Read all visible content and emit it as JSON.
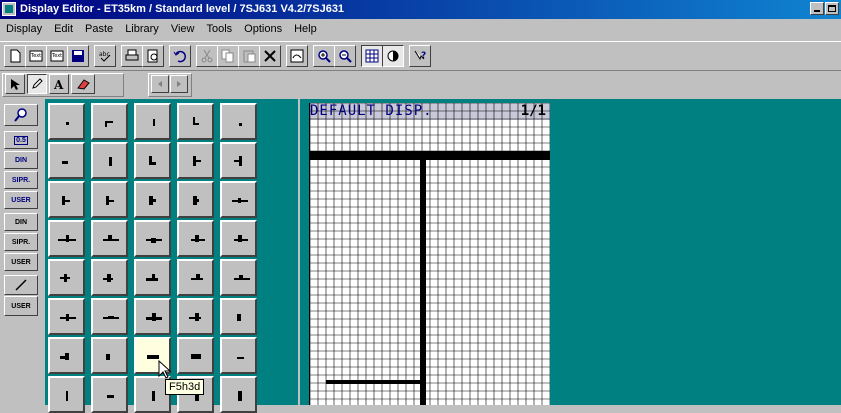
{
  "window": {
    "title": "Display Editor - ET35km / Standard level / 7SJ631 V4.2/7SJ631"
  },
  "menu": [
    "Display",
    "Edit",
    "Paste",
    "Library",
    "View",
    "Tools",
    "Options",
    "Help"
  ],
  "toolbar": {
    "icons": [
      "new-display-icon",
      "import-icon",
      "export-icon",
      "save-icon",
      "spell-check-icon",
      "print-icon",
      "print-preview-icon",
      "undo-icon",
      "cut-icon",
      "copy-icon",
      "paste-icon",
      "delete-icon",
      "rotate-icon",
      "zoom-in-icon",
      "zoom-out-icon",
      "grid-icon",
      "contrast-icon",
      "help-icon"
    ]
  },
  "drawing_tools": {
    "icons": [
      "pointer-icon",
      "pencil-icon",
      "text-icon",
      "eraser-icon",
      "scroll-left-icon",
      "scroll-right-icon"
    ]
  },
  "library_tabs": [
    "search",
    "0.5",
    "DIN",
    "SIPR.",
    "USER",
    "DIN",
    "SIPR.",
    "USER",
    "line",
    "USER"
  ],
  "display": {
    "title": "DEFAULT DISP.",
    "page": "1/1"
  },
  "tooltip": "F5h3d",
  "colors": {
    "titlebar": "#000080",
    "workspace": "#008080",
    "lcd_title": "#000080"
  }
}
